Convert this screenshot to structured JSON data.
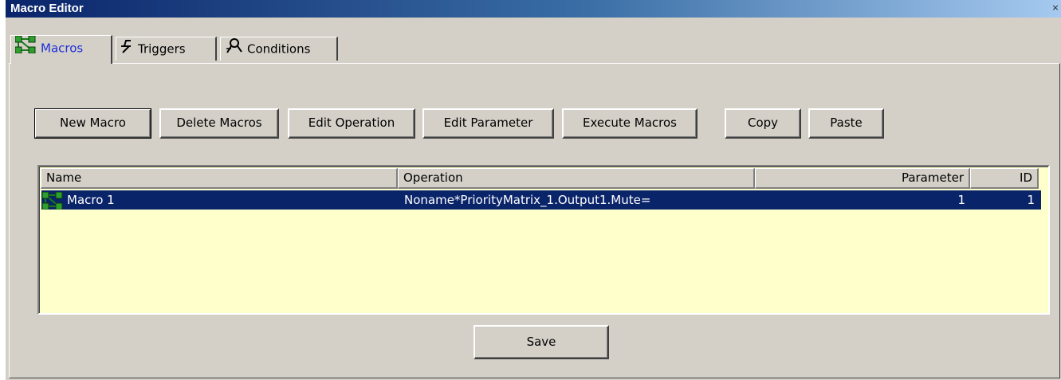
{
  "window": {
    "title": "Macro Editor",
    "close_glyph": "×"
  },
  "tabs": [
    {
      "label": "Macros",
      "icon": "macro-network-icon",
      "active": true
    },
    {
      "label": "Triggers",
      "icon": "trigger-icon",
      "active": false
    },
    {
      "label": "Conditions",
      "icon": "conditions-icon",
      "active": false
    }
  ],
  "toolbar": {
    "new_macro": "New Macro",
    "delete_macros": "Delete Macros",
    "edit_operation": "Edit Operation",
    "edit_parameter": "Edit Parameter",
    "execute_macros": "Execute Macros",
    "copy": "Copy",
    "paste": "Paste"
  },
  "table": {
    "columns": [
      "Name",
      "Operation",
      "Parameter",
      "ID"
    ],
    "rows": [
      {
        "name": "Macro 1",
        "operation": "Noname*PriorityMatrix_1.Output1.Mute=",
        "parameter": "1",
        "id": "1",
        "selected": true,
        "icon": "macro-network-icon"
      }
    ]
  },
  "footer": {
    "save": "Save"
  },
  "colors": {
    "selection": "#0a246a",
    "list_background": "#ffffcc",
    "active_tab_text": "#1d2fd8",
    "face": "#d4d0c8"
  }
}
